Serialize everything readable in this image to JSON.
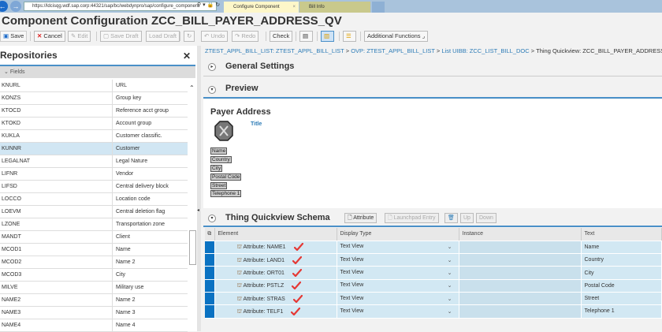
{
  "browser": {
    "url": "https://ldcisqg.wdf.sap.corp:44321/sap/bc/webdynpro/sap/configure_component",
    "tabs": [
      {
        "label": "Configure Component",
        "active": true
      },
      {
        "label": "Bill Info",
        "active": false
      }
    ]
  },
  "header": {
    "title": "Component Configuration ZCC_BILL_PAYER_ADDRESS_QV"
  },
  "toolbar": {
    "save": "Save",
    "cancel": "Cancel",
    "edit": "Edit",
    "save_draft": "Save Draft",
    "load_draft": "Load Draft",
    "undo": "Undo",
    "redo": "Redo",
    "check": "Check",
    "additional": "Additional Functions"
  },
  "repositories": {
    "title": "Repositories",
    "group": "Fields",
    "selected": "KUNNR",
    "rows": [
      [
        "KNURL",
        "URL"
      ],
      [
        "KONZS",
        "Group key"
      ],
      [
        "KTOCD",
        "Reference acct group"
      ],
      [
        "KTOKD",
        "Account group"
      ],
      [
        "KUKLA",
        "Customer classific."
      ],
      [
        "KUNNR",
        "Customer"
      ],
      [
        "LEGALNAT",
        "Legal Nature"
      ],
      [
        "LIFNR",
        "Vendor"
      ],
      [
        "LIFSD",
        "Central delivery block"
      ],
      [
        "LOCCO",
        "Location code"
      ],
      [
        "LOEVM",
        "Central deletion flag"
      ],
      [
        "LZONE",
        "Transportation zone"
      ],
      [
        "MANDT",
        "Client"
      ],
      [
        "MCOD1",
        "Name"
      ],
      [
        "MCOD2",
        "Name 2"
      ],
      [
        "MCOD3",
        "City"
      ],
      [
        "MILVE",
        "Military use"
      ],
      [
        "NAME2",
        "Name 2"
      ],
      [
        "NAME3",
        "Name 3"
      ],
      [
        "NAME4",
        "Name 4"
      ]
    ]
  },
  "breadcrumb": {
    "items": [
      "ZTEST_APPL_BILL_LIST: ZTEST_APPL_BILL_LIST",
      "OVP: ZTEST_APPL_BILL_LIST",
      "List UIBB: ZCC_LIST_BILL_DOC"
    ],
    "current": "Thing Quickview: ZCC_BILL_PAYER_ADDRESS_QV",
    "sep": ">"
  },
  "sections": {
    "general": "General Settings",
    "preview": "Preview",
    "schema": "Thing Quickview Schema"
  },
  "preview": {
    "heading": "Payer Address",
    "title_link": "Title",
    "labels": [
      "Name",
      "Country",
      "City",
      "Postal Code",
      "Street",
      "Telephone 1"
    ]
  },
  "schema": {
    "buttons": {
      "attribute": "Attribute",
      "launchpad": "Launchpad Entry",
      "up": "Up",
      "down": "Down"
    },
    "columns": [
      "Element",
      "Display Type",
      "Instance",
      "Text"
    ],
    "rows": [
      {
        "element": "Attribute: NAME1",
        "display": "Text View",
        "instance": "",
        "text": "Name"
      },
      {
        "element": "Attribute: LAND1",
        "display": "Text View",
        "instance": "",
        "text": "Country"
      },
      {
        "element": "Attribute: ORT01",
        "display": "Text View",
        "instance": "",
        "text": "City"
      },
      {
        "element": "Attribute: PSTLZ",
        "display": "Text View",
        "instance": "",
        "text": "Postal Code"
      },
      {
        "element": "Attribute: STRAS",
        "display": "Text View",
        "instance": "",
        "text": "Street"
      },
      {
        "element": "Attribute: TELF1",
        "display": "Text View",
        "instance": "",
        "text": "Telephone 1"
      }
    ]
  },
  "colors": {
    "accent": "#0a72c2",
    "selected_row": "#d1e6f3",
    "check": "#e53935"
  }
}
